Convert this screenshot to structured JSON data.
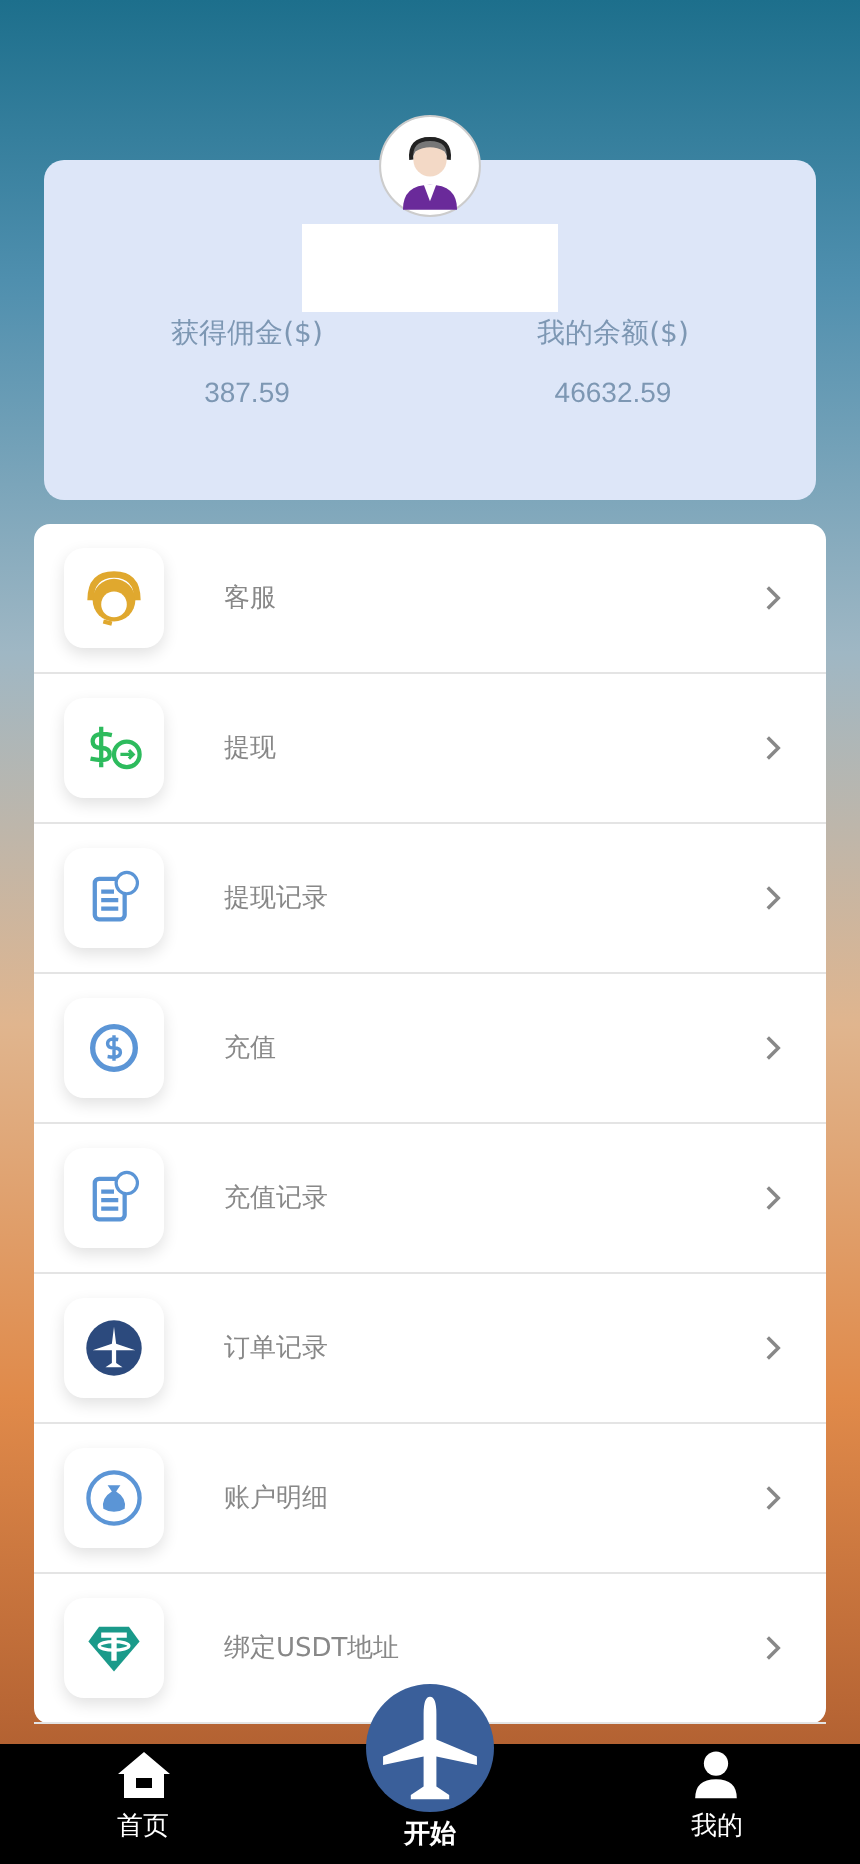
{
  "balance_card": {
    "stats": [
      {
        "label": "获得佣金($)",
        "value": "387.59"
      },
      {
        "label": "我的余额($)",
        "value": "46632.59"
      }
    ]
  },
  "menu": [
    {
      "kind": "support",
      "label": "客服"
    },
    {
      "kind": "withdraw",
      "label": "提现"
    },
    {
      "kind": "record",
      "label": "提现记录"
    },
    {
      "kind": "deposit",
      "label": "充值"
    },
    {
      "kind": "record",
      "label": "充值记录"
    },
    {
      "kind": "plane",
      "label": "订单记录"
    },
    {
      "kind": "moneybag",
      "label": "账户明细"
    },
    {
      "kind": "usdt",
      "label": "绑定USDT地址"
    }
  ],
  "bottom_nav": [
    {
      "kind": "home",
      "label": "首页"
    },
    {
      "kind": "start",
      "label": "开始"
    },
    {
      "kind": "profile",
      "label": "我的"
    }
  ]
}
